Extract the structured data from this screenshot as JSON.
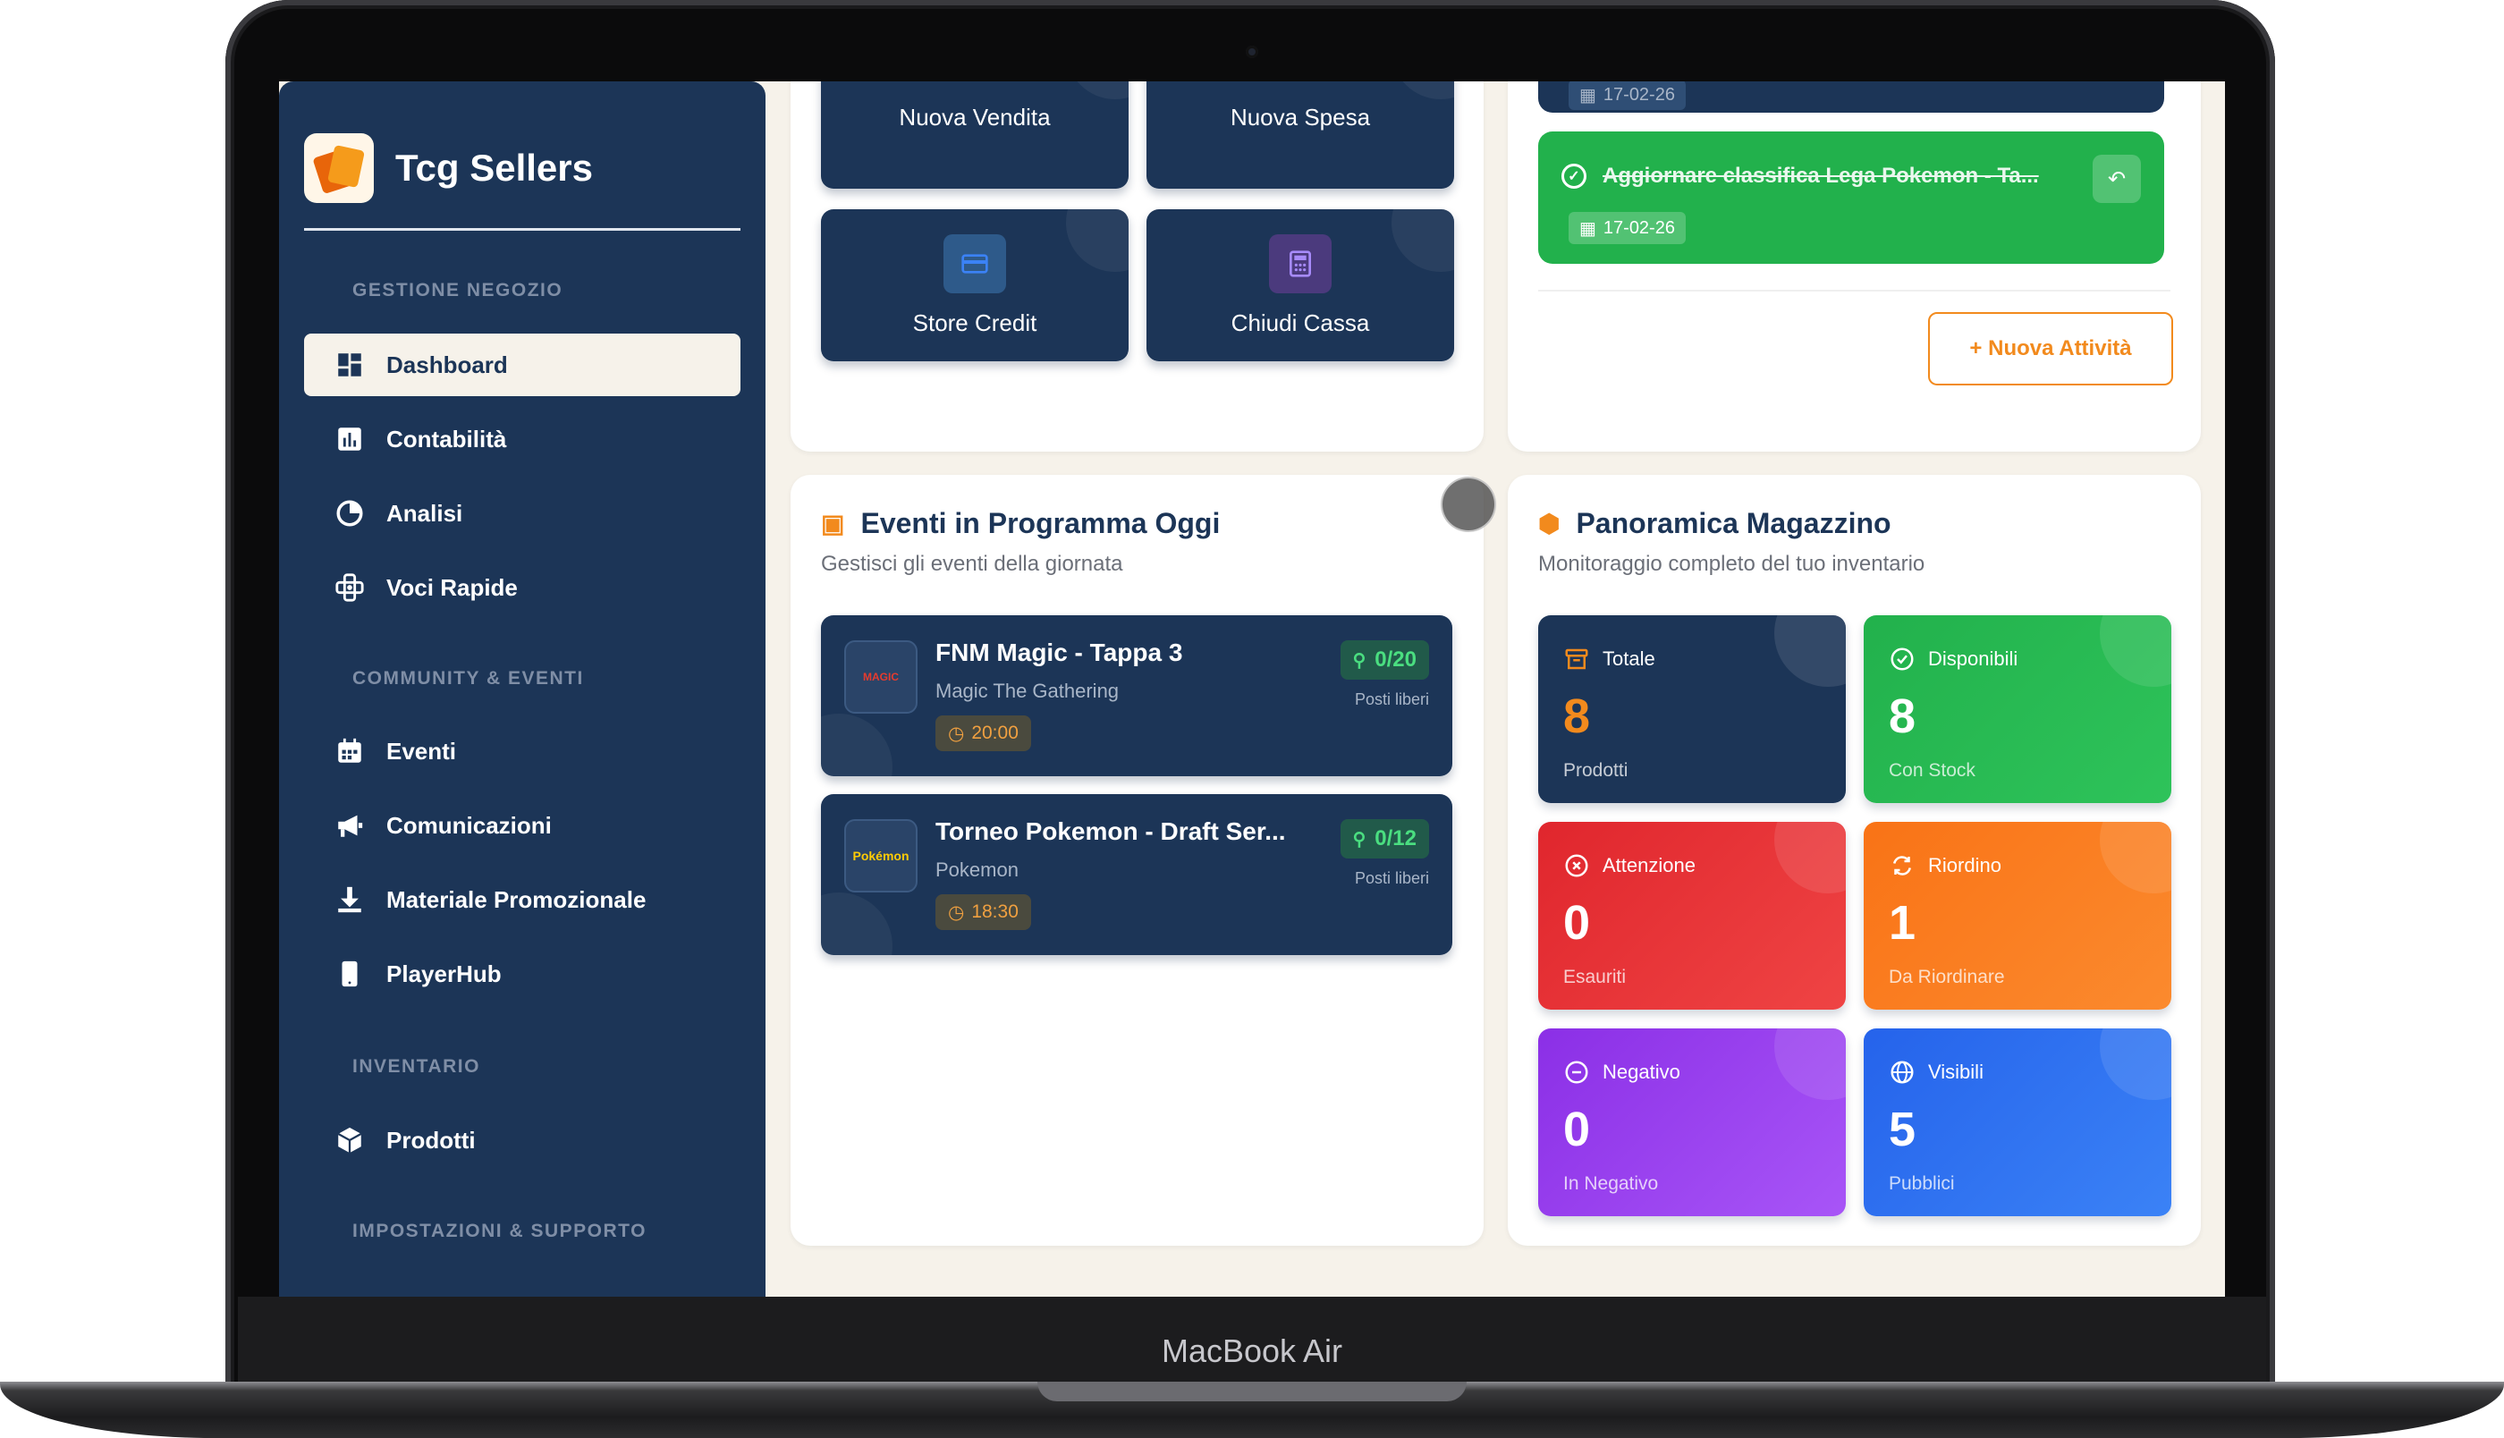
{
  "device": {
    "model_label": "MacBook Air"
  },
  "sidebar": {
    "brand": "Tcg Sellers",
    "sections": [
      {
        "title": "GESTIONE NEGOZIO"
      },
      {
        "title": "COMMUNITY & EVENTI"
      },
      {
        "title": "INVENTARIO"
      },
      {
        "title": "IMPOSTAZIONI & SUPPORTO"
      }
    ],
    "items": [
      {
        "label": "Dashboard",
        "icon": "dashboard-icon",
        "active": true
      },
      {
        "label": "Contabilità",
        "icon": "bar-chart-icon"
      },
      {
        "label": "Analisi",
        "icon": "pie-chart-icon"
      },
      {
        "label": "Voci Rapide",
        "icon": "quick-entries-icon"
      },
      {
        "label": "Eventi",
        "icon": "calendar-icon"
      },
      {
        "label": "Comunicazioni",
        "icon": "megaphone-icon"
      },
      {
        "label": "Materiale Promozionale",
        "icon": "download-icon"
      },
      {
        "label": "PlayerHub",
        "icon": "mobile-icon"
      },
      {
        "label": "Prodotti",
        "icon": "box-icon"
      }
    ]
  },
  "quick_actions": [
    {
      "label": "Nuova Vendita",
      "icon": "sale-icon"
    },
    {
      "label": "Nuova Spesa",
      "icon": "expense-icon"
    },
    {
      "label": "Store Credit",
      "icon": "credit-card-icon",
      "color": "#3b82f6"
    },
    {
      "label": "Chiudi Cassa",
      "icon": "calculator-icon",
      "color": "#8b5cf6"
    }
  ],
  "tasks": {
    "items": [
      {
        "title": "",
        "date": "17-02-26",
        "done": false
      },
      {
        "title": "Aggiornare classifica Lega Pokemon - Ta...",
        "date": "17-02-26",
        "done": true,
        "color": "#22a94a"
      }
    ],
    "new_button": "+ Nuova Attività"
  },
  "events": {
    "title": "Eventi in Programma Oggi",
    "subtitle": "Gestisci gli eventi della giornata",
    "items": [
      {
        "name": "FNM Magic - Tappa 3",
        "game": "Magic The Gathering",
        "time": "20:00",
        "seats": "0/20",
        "seats_label": "Posti liberi",
        "logo_text": "MAGIC"
      },
      {
        "name": "Torneo Pokemon - Draft Ser...",
        "game": "Pokemon",
        "time": "18:30",
        "seats": "0/12",
        "seats_label": "Posti liberi",
        "logo_text": "Pokémon"
      }
    ]
  },
  "inventory": {
    "title": "Panoramica Magazzino",
    "subtitle": "Monitoraggio completo del tuo inventario",
    "stats": [
      {
        "label": "Totale",
        "value": "8",
        "foot": "Prodotti",
        "icon": "archive-icon",
        "color": "#1c3557",
        "value_color": "#f28a1d"
      },
      {
        "label": "Disponibili",
        "value": "8",
        "foot": "Con Stock",
        "icon": "check-circle-icon",
        "color": "#22b14c"
      },
      {
        "label": "Attenzione",
        "value": "0",
        "foot": "Esauriti",
        "icon": "x-circle-icon",
        "color": "#e53935"
      },
      {
        "label": "Riordino",
        "value": "1",
        "foot": "Da Riordinare",
        "icon": "refresh-icon",
        "color": "#f97316"
      },
      {
        "label": "Negativo",
        "value": "0",
        "foot": "In Negativo",
        "icon": "minus-circle-icon",
        "color": "#9333ea"
      },
      {
        "label": "Visibili",
        "value": "5",
        "foot": "Pubblici",
        "icon": "globe-icon",
        "color": "#2f6fe4"
      }
    ]
  }
}
